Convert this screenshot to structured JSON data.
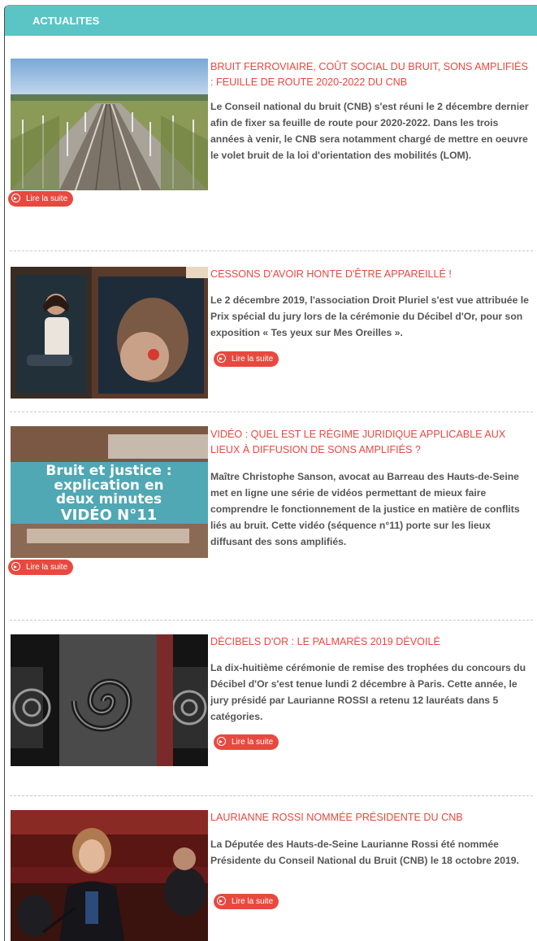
{
  "header": {
    "title": "ACTUALITES"
  },
  "read_more_label": "Lire la suite",
  "colors": {
    "header_bg": "#5bc5c5",
    "accent": "#e8493f",
    "text": "#555555"
  },
  "articles": [
    {
      "title": "BRUIT FERROVIAIRE, COÛT SOCIAL DU BRUIT, SONS AMPLIFIÉS : FEUILLE DE ROUTE 2020-2022 DU CNB",
      "summary": "Le Conseil national du bruit (CNB) s'est réuni le 2 décembre dernier afin de fixer sa feuille de route pour 2020-2022. Dans les trois années à venir, le CNB sera notamment chargé de mettre en oeuvre le volet bruit de la loi d'orientation des mobilités (LOM).",
      "read_more": "Lire la suite"
    },
    {
      "title": "CESSONS D'AVOIR HONTE D'ÊTRE APPAREILLÉ !",
      "summary": "Le 2 décembre 2019, l'association Droit Pluriel s'est vue attribuée le Prix spécial du jury lors de la cérémonie du Décibel d'Or, pour son exposition « Tes yeux sur Mes Oreilles ».",
      "read_more": "Lire la suite"
    },
    {
      "title": "VIDÉO : QUEL EST LE RÉGIME JURIDIQUE APPLICABLE AUX LIEUX À DIFFUSION DE SONS AMPLIFIÉS ?",
      "summary": "Maître Christophe Sanson, avocat au Barreau des Hauts-de-Seine met en ligne une série de vidéos permettant de mieux faire comprendre le fonctionnement de la justice en matière de conflits liés au bruit. Cette vidéo (séquence n°11) porte sur les lieux diffusant des sons amplifiés.",
      "read_more": "Lire la suite",
      "image_text": [
        "Bruit et justice :",
        "explication en",
        "deux minutes",
        "VIDÉO N°11"
      ]
    },
    {
      "title": "DÉCIBELS D'OR : LE PALMARÈS 2019 DÉVOILÉ",
      "summary": "La dix-huitième cérémonie de remise des trophées du concours du Décibel d'Or s'est tenue lundi 2 décembre à Paris. Cette année, le jury présidé par Laurianne ROSSI a retenu 12 lauréats dans 5 catégories.",
      "read_more": "Lire la suite"
    },
    {
      "title": "LAURIANNE ROSSI NOMMÉE PRÉSIDENTE DU CNB",
      "summary": "La Députée des Hauts-de-Seine Laurianne Rossi été nommée Présidente du Conseil National du Bruit (CNB) le 18 octobre 2019.",
      "read_more": "Lire la suite"
    }
  ]
}
